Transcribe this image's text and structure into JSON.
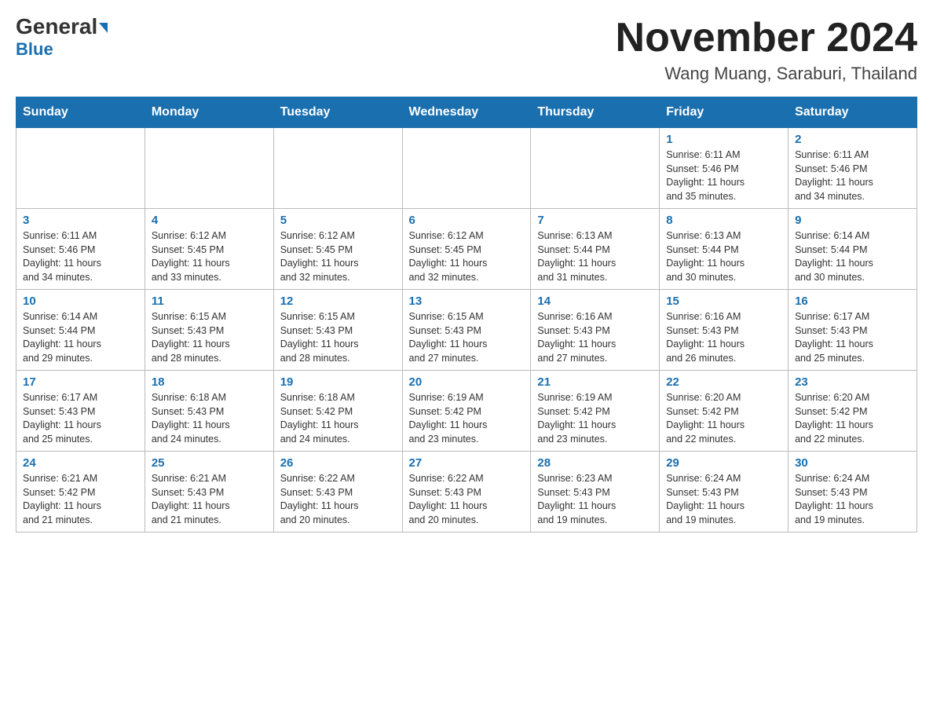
{
  "header": {
    "logo_general": "General",
    "logo_blue": "Blue",
    "month_title": "November 2024",
    "location": "Wang Muang, Saraburi, Thailand"
  },
  "weekdays": [
    "Sunday",
    "Monday",
    "Tuesday",
    "Wednesday",
    "Thursday",
    "Friday",
    "Saturday"
  ],
  "weeks": [
    [
      {
        "day": "",
        "info": ""
      },
      {
        "day": "",
        "info": ""
      },
      {
        "day": "",
        "info": ""
      },
      {
        "day": "",
        "info": ""
      },
      {
        "day": "",
        "info": ""
      },
      {
        "day": "1",
        "info": "Sunrise: 6:11 AM\nSunset: 5:46 PM\nDaylight: 11 hours\nand 35 minutes."
      },
      {
        "day": "2",
        "info": "Sunrise: 6:11 AM\nSunset: 5:46 PM\nDaylight: 11 hours\nand 34 minutes."
      }
    ],
    [
      {
        "day": "3",
        "info": "Sunrise: 6:11 AM\nSunset: 5:46 PM\nDaylight: 11 hours\nand 34 minutes."
      },
      {
        "day": "4",
        "info": "Sunrise: 6:12 AM\nSunset: 5:45 PM\nDaylight: 11 hours\nand 33 minutes."
      },
      {
        "day": "5",
        "info": "Sunrise: 6:12 AM\nSunset: 5:45 PM\nDaylight: 11 hours\nand 32 minutes."
      },
      {
        "day": "6",
        "info": "Sunrise: 6:12 AM\nSunset: 5:45 PM\nDaylight: 11 hours\nand 32 minutes."
      },
      {
        "day": "7",
        "info": "Sunrise: 6:13 AM\nSunset: 5:44 PM\nDaylight: 11 hours\nand 31 minutes."
      },
      {
        "day": "8",
        "info": "Sunrise: 6:13 AM\nSunset: 5:44 PM\nDaylight: 11 hours\nand 30 minutes."
      },
      {
        "day": "9",
        "info": "Sunrise: 6:14 AM\nSunset: 5:44 PM\nDaylight: 11 hours\nand 30 minutes."
      }
    ],
    [
      {
        "day": "10",
        "info": "Sunrise: 6:14 AM\nSunset: 5:44 PM\nDaylight: 11 hours\nand 29 minutes."
      },
      {
        "day": "11",
        "info": "Sunrise: 6:15 AM\nSunset: 5:43 PM\nDaylight: 11 hours\nand 28 minutes."
      },
      {
        "day": "12",
        "info": "Sunrise: 6:15 AM\nSunset: 5:43 PM\nDaylight: 11 hours\nand 28 minutes."
      },
      {
        "day": "13",
        "info": "Sunrise: 6:15 AM\nSunset: 5:43 PM\nDaylight: 11 hours\nand 27 minutes."
      },
      {
        "day": "14",
        "info": "Sunrise: 6:16 AM\nSunset: 5:43 PM\nDaylight: 11 hours\nand 27 minutes."
      },
      {
        "day": "15",
        "info": "Sunrise: 6:16 AM\nSunset: 5:43 PM\nDaylight: 11 hours\nand 26 minutes."
      },
      {
        "day": "16",
        "info": "Sunrise: 6:17 AM\nSunset: 5:43 PM\nDaylight: 11 hours\nand 25 minutes."
      }
    ],
    [
      {
        "day": "17",
        "info": "Sunrise: 6:17 AM\nSunset: 5:43 PM\nDaylight: 11 hours\nand 25 minutes."
      },
      {
        "day": "18",
        "info": "Sunrise: 6:18 AM\nSunset: 5:43 PM\nDaylight: 11 hours\nand 24 minutes."
      },
      {
        "day": "19",
        "info": "Sunrise: 6:18 AM\nSunset: 5:42 PM\nDaylight: 11 hours\nand 24 minutes."
      },
      {
        "day": "20",
        "info": "Sunrise: 6:19 AM\nSunset: 5:42 PM\nDaylight: 11 hours\nand 23 minutes."
      },
      {
        "day": "21",
        "info": "Sunrise: 6:19 AM\nSunset: 5:42 PM\nDaylight: 11 hours\nand 23 minutes."
      },
      {
        "day": "22",
        "info": "Sunrise: 6:20 AM\nSunset: 5:42 PM\nDaylight: 11 hours\nand 22 minutes."
      },
      {
        "day": "23",
        "info": "Sunrise: 6:20 AM\nSunset: 5:42 PM\nDaylight: 11 hours\nand 22 minutes."
      }
    ],
    [
      {
        "day": "24",
        "info": "Sunrise: 6:21 AM\nSunset: 5:42 PM\nDaylight: 11 hours\nand 21 minutes."
      },
      {
        "day": "25",
        "info": "Sunrise: 6:21 AM\nSunset: 5:43 PM\nDaylight: 11 hours\nand 21 minutes."
      },
      {
        "day": "26",
        "info": "Sunrise: 6:22 AM\nSunset: 5:43 PM\nDaylight: 11 hours\nand 20 minutes."
      },
      {
        "day": "27",
        "info": "Sunrise: 6:22 AM\nSunset: 5:43 PM\nDaylight: 11 hours\nand 20 minutes."
      },
      {
        "day": "28",
        "info": "Sunrise: 6:23 AM\nSunset: 5:43 PM\nDaylight: 11 hours\nand 19 minutes."
      },
      {
        "day": "29",
        "info": "Sunrise: 6:24 AM\nSunset: 5:43 PM\nDaylight: 11 hours\nand 19 minutes."
      },
      {
        "day": "30",
        "info": "Sunrise: 6:24 AM\nSunset: 5:43 PM\nDaylight: 11 hours\nand 19 minutes."
      }
    ]
  ]
}
